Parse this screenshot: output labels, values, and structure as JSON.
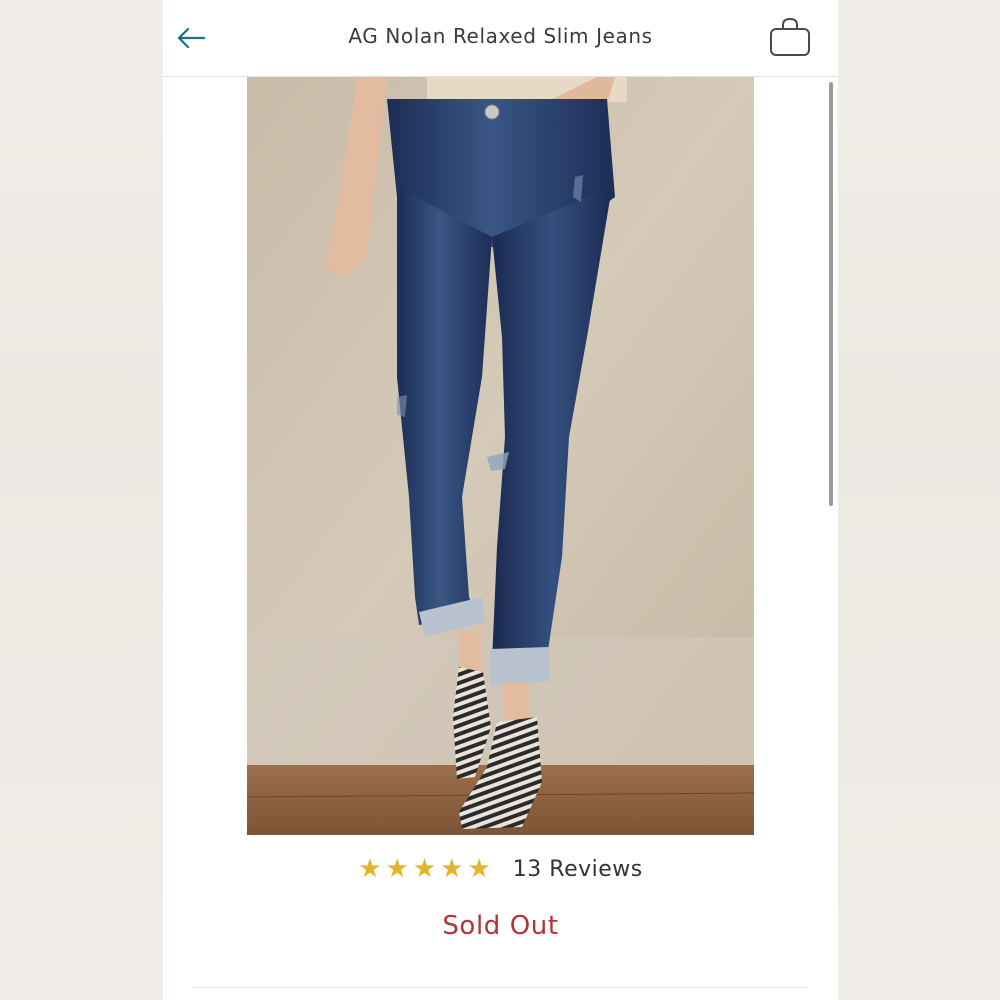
{
  "header": {
    "title": "AG Nolan Relaxed Slim Jeans",
    "back_icon": "back-arrow-icon",
    "bag_icon": "shopping-bag-icon"
  },
  "product": {
    "image_alt": "Model wearing dark wash relaxed slim jeans with rolled cuffs and striped slip-on sneakers"
  },
  "rating": {
    "stars": 5,
    "reviews_label": "13 Reviews"
  },
  "status": {
    "label": "Sold Out"
  },
  "colors": {
    "accent": "#1a6f8a",
    "star": "#e4b42b",
    "sold_out": "#b0353a"
  }
}
